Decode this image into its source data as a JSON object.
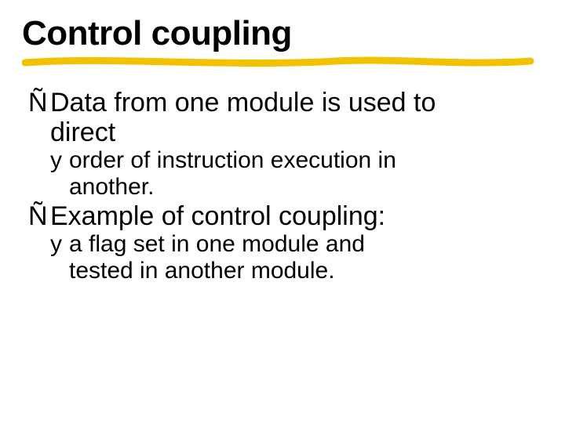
{
  "slide": {
    "title": "Control coupling",
    "bullets": [
      {
        "marker": "Ñ",
        "line": "Data from one module is used to",
        "cont": "direct",
        "sub": {
          "marker": "y",
          "line": "order of instruction execution in",
          "cont": "another."
        }
      },
      {
        "marker": "Ñ",
        "line": "Example of control coupling:",
        "cont": null,
        "sub": {
          "marker": "y",
          "line": "a flag set in one module and",
          "cont": "tested in another module."
        }
      }
    ]
  }
}
